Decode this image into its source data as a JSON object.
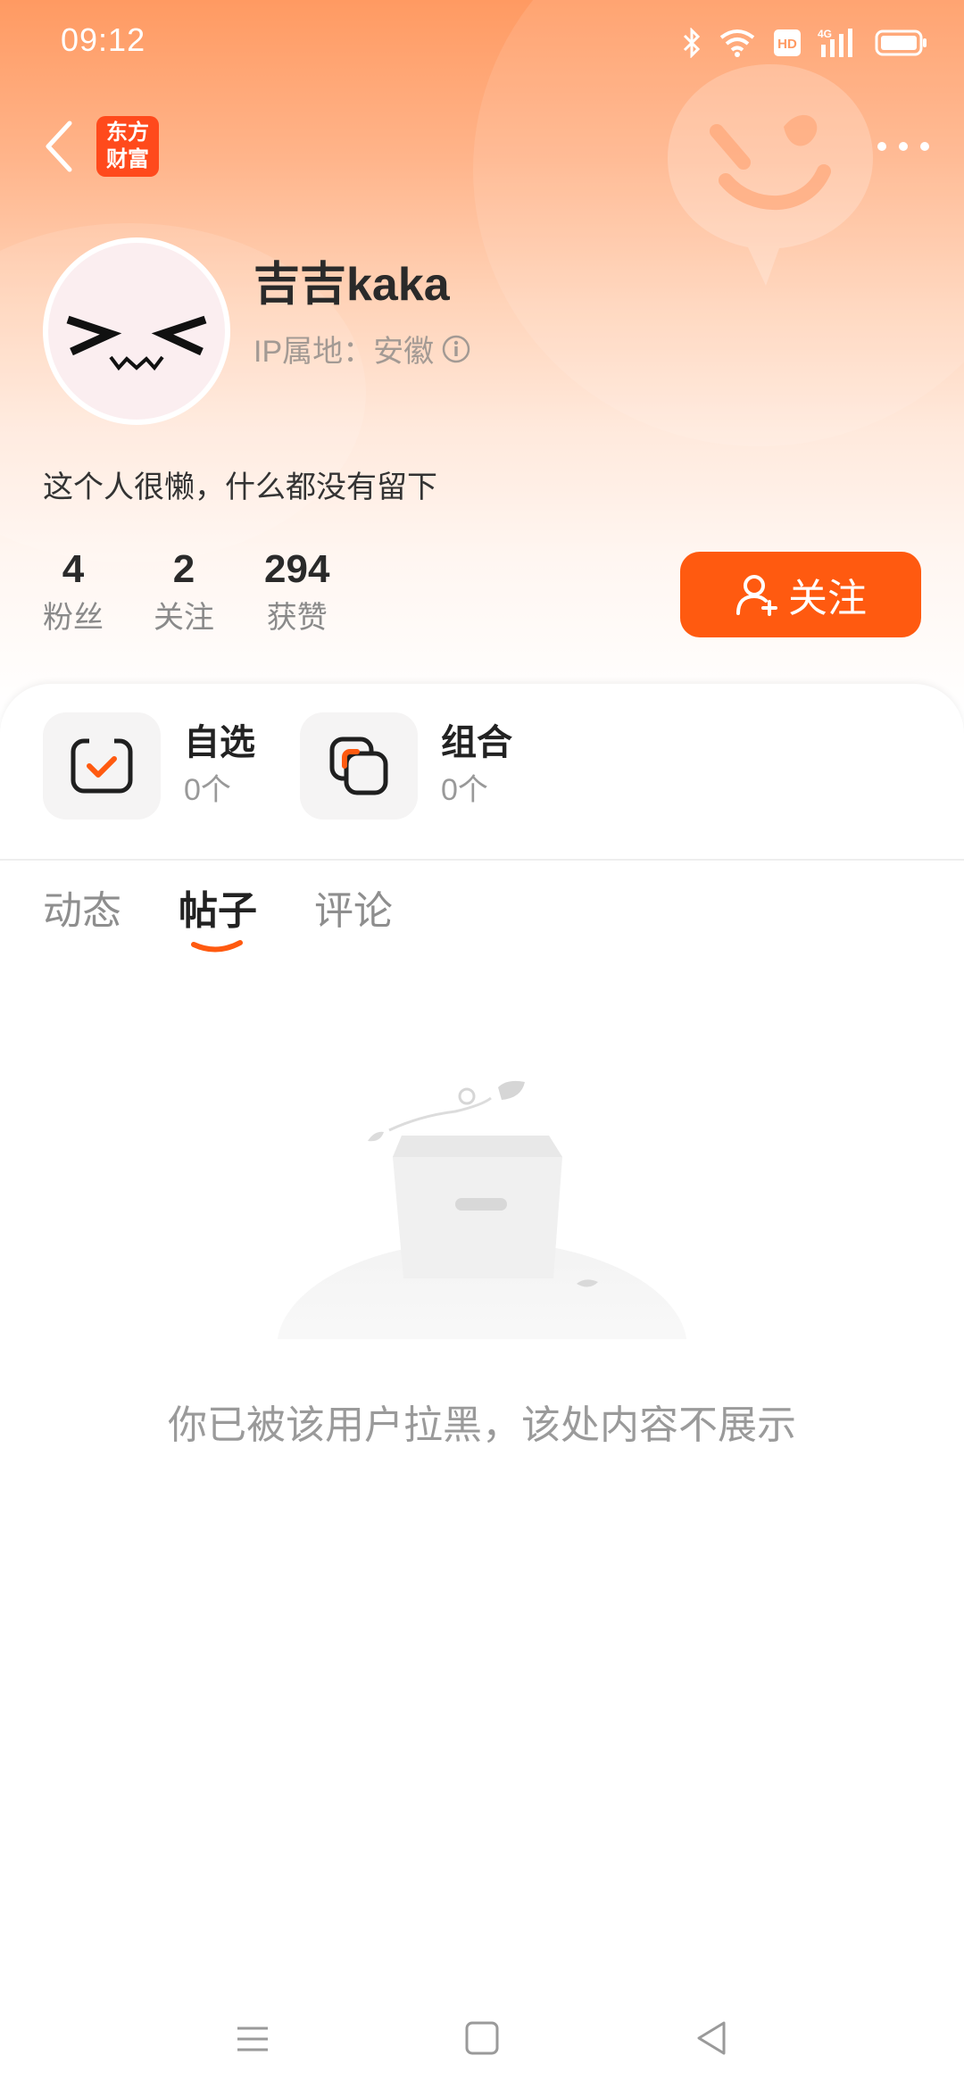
{
  "status_bar": {
    "time": "09:12"
  },
  "nav": {
    "logo_line1": "东方",
    "logo_line2": "财富"
  },
  "profile": {
    "username": "吉吉kaka",
    "ip_location": "IP属地：安徽",
    "bio": "这个人很懒，什么都没有留下"
  },
  "stats": [
    {
      "value": "4",
      "label": "粉丝"
    },
    {
      "value": "2",
      "label": "关注"
    },
    {
      "value": "294",
      "label": "获赞"
    }
  ],
  "follow_button": {
    "label": "关注"
  },
  "cards": [
    {
      "title": "自选",
      "count": "0个"
    },
    {
      "title": "组合",
      "count": "0个"
    }
  ],
  "tabs": [
    {
      "label": "动态"
    },
    {
      "label": "帖子",
      "active": true
    },
    {
      "label": "评论"
    }
  ],
  "empty_state": {
    "message": "你已被该用户拉黑，该处内容不展示"
  },
  "colors": {
    "accent": "#ff5a10",
    "header_top": "#ff9a62"
  }
}
